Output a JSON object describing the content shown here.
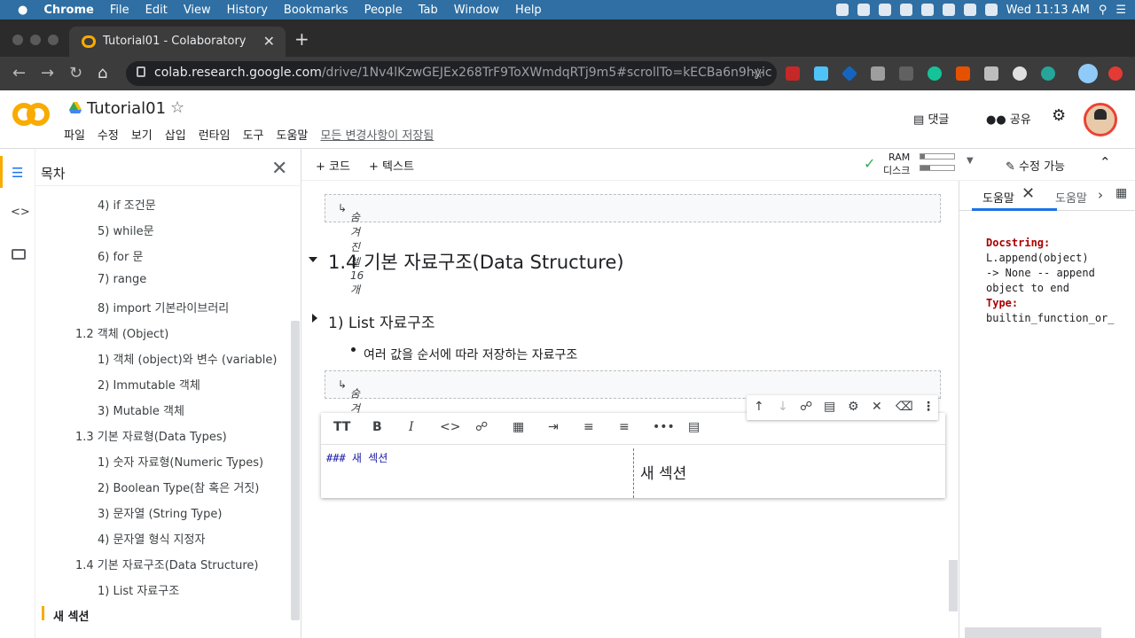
{
  "mac": {
    "app": "Chrome",
    "menus": [
      "File",
      "Edit",
      "View",
      "History",
      "Bookmarks",
      "People",
      "Tab",
      "Window",
      "Help"
    ],
    "clock": "Wed 11:13 AM"
  },
  "browser": {
    "tab_title": "Tutorial01 - Colaboratory",
    "url_host": "colab.research.google.com",
    "url_path": "/drive/1Nv4lKzwGEJEx268TrF9ToXWmdqRTj9m5#scrollTo=kECBa6n9hyic"
  },
  "colab": {
    "doc_title": "Tutorial01",
    "menus": [
      "파일",
      "수정",
      "보기",
      "삽입",
      "런타임",
      "도구",
      "도움말"
    ],
    "saved_status": "모든 변경사항이 저장됨",
    "comment_label": "댓글",
    "share_label": "공유",
    "add_code": "+ 코드",
    "add_text": "+ 텍스트",
    "ram_label": "RAM",
    "disk_label": "디스크",
    "ram_usage": 0.12,
    "disk_usage": 0.3,
    "edit_mode": "수정 가능"
  },
  "toc": {
    "title": "목차",
    "items": [
      {
        "label": "4) if 조건문",
        "level": 2
      },
      {
        "label": "5) while문",
        "level": 2
      },
      {
        "label": "6) for 문",
        "level": 2
      },
      {
        "label": "7) range",
        "level": 2
      },
      {
        "label": "8) import 기본라이브러리",
        "level": 2
      },
      {
        "label": "1.2 객체 (Object)",
        "level": 1
      },
      {
        "label": "1) 객체 (object)와 변수 (variable)",
        "level": 2
      },
      {
        "label": "2) Immutable 객체",
        "level": 2
      },
      {
        "label": "3) Mutable 객체",
        "level": 2
      },
      {
        "label": "1.3 기본 자료형(Data Types)",
        "level": 1
      },
      {
        "label": "1) 숫자 자료형(Numeric Types)",
        "level": 2
      },
      {
        "label": "2) Boolean Type(참 혹은 거짓)",
        "level": 2
      },
      {
        "label": "3) 문자열 (String Type)",
        "level": 2
      },
      {
        "label": "4) 문자열 형식 지정자",
        "level": 2
      },
      {
        "label": "1.4 기본 자료구조(Data Structure)",
        "level": 1
      },
      {
        "label": "1) List 자료구조",
        "level": 2
      }
    ],
    "current": "새 섹션"
  },
  "notebook": {
    "hidden_cells_1": "숨겨진 셀 16개",
    "heading_14": "1.4 기본 자료구조(Data Structure)",
    "heading_list": "1) List 자료구조",
    "bullet": "여러 값을 순서에 따라 저장하는 자료구조",
    "hidden_cells_2": "숨겨진 셀 9개",
    "markdown_source": "### 새 섹션",
    "markdown_preview": "새 섹션"
  },
  "help": {
    "tab_active": "도움말",
    "tab_next": "도움말",
    "docstring_label": "Docstring:",
    "doc_lines": [
      "L.append(object)",
      "-> None -- append",
      "object to end"
    ],
    "type_label": "Type:",
    "type_value": "builtin_function_or_"
  },
  "colors": {
    "accent": "#f9ab00",
    "link": "#1a73e8",
    "mac_bar": "#2f6fa3"
  }
}
